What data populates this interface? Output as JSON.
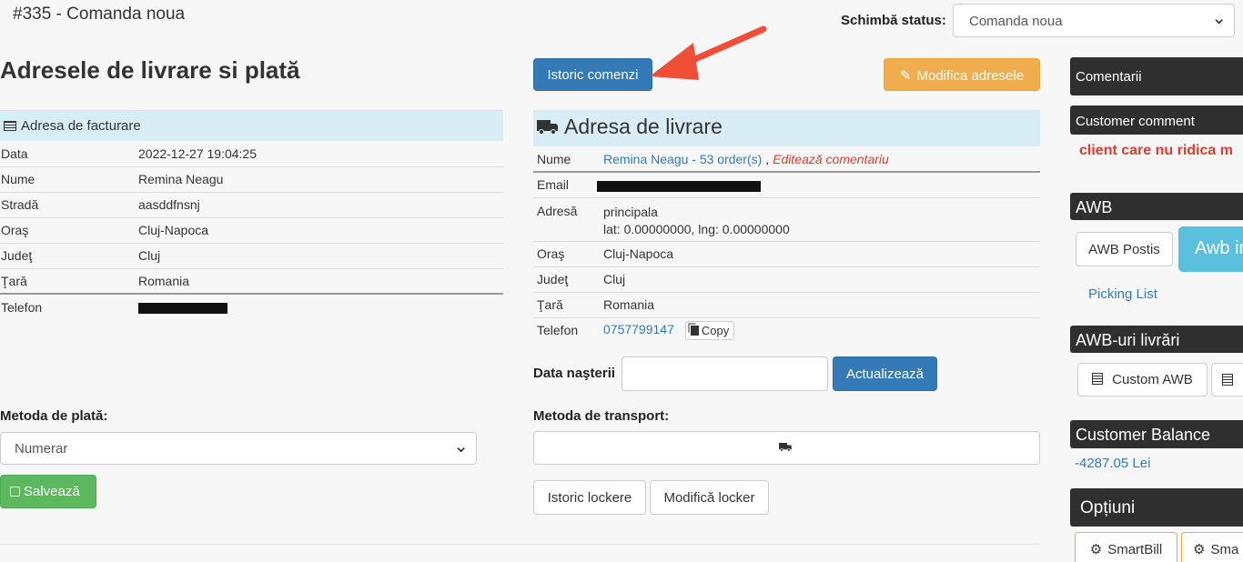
{
  "header": {
    "order_title": "#335 - Comanda noua",
    "status_label": "Schimbă status:",
    "status_value": "Comanda noua"
  },
  "left": {
    "heading": "Adresele de livrare si plată",
    "billing_header": "Adresa de facturare",
    "billing_rows": [
      {
        "label": "Data",
        "value": "2022-12-27 19:04:25"
      },
      {
        "label": "Nume",
        "value": "Remina Neagu"
      },
      {
        "label": "Stradă",
        "value": "aasddfnsnj"
      },
      {
        "label": "Oraş",
        "value": "Cluj-Napoca"
      },
      {
        "label": "Judeţ",
        "value": "Cluj"
      },
      {
        "label": "Ţară",
        "value": "Romania"
      },
      {
        "label": "Telefon",
        "value": ""
      }
    ],
    "payment_label": "Metoda de plată:",
    "payment_value": "Numerar",
    "save_label": "Salvează"
  },
  "middle": {
    "history_button": "Istoric comenzi",
    "modify_button": "Modifica adresele",
    "shipping_header": "Adresa de livrare",
    "name_label": "Nume",
    "name_link": "Remina Neagu - 53 order(s)",
    "name_sep": ",",
    "edit_comment": "Editează comentariu",
    "email_label": "Email",
    "address_label": "Adresă",
    "address_line1": "principala",
    "address_line2": "lat: 0.00000000, lng: 0.00000000",
    "city_label": "Oraş",
    "city_value": "Cluj-Napoca",
    "county_label": "Judeţ",
    "county_value": "Cluj",
    "country_label": "Ţară",
    "country_value": "Romania",
    "phone_label": "Telefon",
    "phone_value": "0757799147",
    "copy_label": "Copy",
    "dob_label": "Data naşterii",
    "update_button": "Actualizează",
    "transport_label": "Metoda de transport:",
    "locker_history_button": "Istoric lockere",
    "locker_modify_button": "Modifică locker"
  },
  "sidebar": {
    "comments_title": "Comentarii",
    "customer_comment_title": "Customer comment",
    "customer_comment_text": "client care nu ridica m",
    "awb_title": "AWB",
    "awb_postis": "AWB Postis",
    "awb_cut": "Awb in",
    "picking_list": "Picking List",
    "awb_deliveries_title": "AWB-uri livrări",
    "custom_awb": "Custom AWB",
    "balance_title": "Customer Balance",
    "balance_value": "-4287.05 Lei",
    "options_title": "Opțiuni",
    "smartbill_1": "SmartBill",
    "smartbill_2": "Sma"
  },
  "colors": {
    "primary": "#337ab7",
    "warning": "#f0ad4e",
    "success": "#5cb85c",
    "danger_text": "#e03c31",
    "info_bg": "#d9edf7",
    "sidebar_dark": "#2f2f2f",
    "arrow": "#f04e36"
  }
}
